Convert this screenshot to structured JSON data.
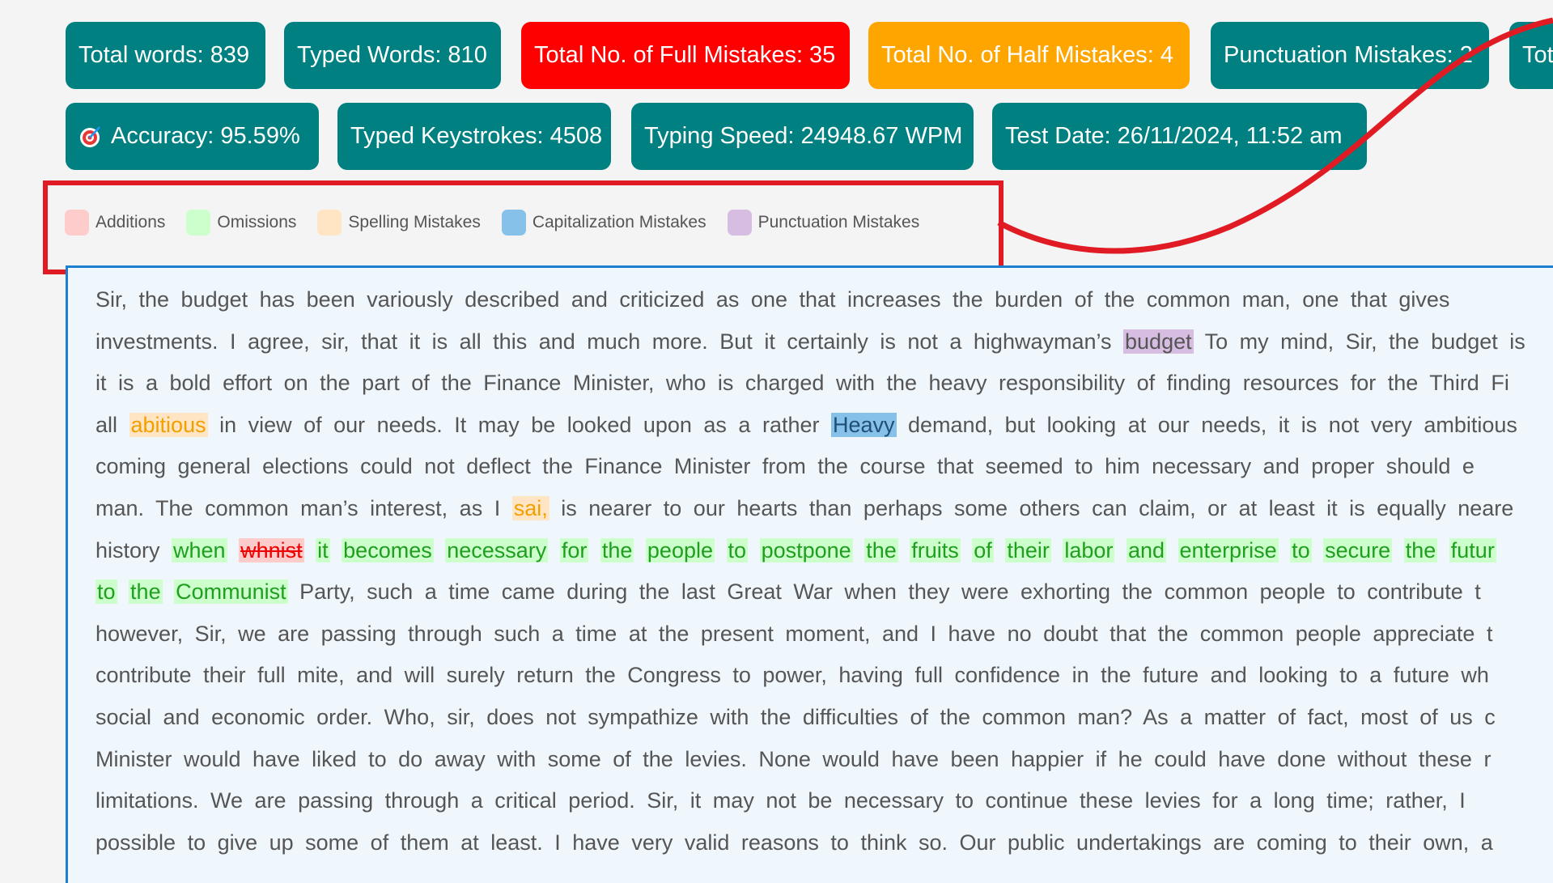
{
  "stats_row1": [
    {
      "label": "Total words: 839",
      "color": "#008080"
    },
    {
      "label": "Typed Words: 810",
      "color": "#008080"
    },
    {
      "label": "Total No. of Full Mistakes: 35",
      "color": "#ff0000"
    },
    {
      "label": "Total No. of Half Mistakes: 4",
      "color": "#ffa500"
    },
    {
      "label": "Punctuation Mistakes: 2",
      "color": "#008080"
    },
    {
      "label": "Tot",
      "color": "#008080"
    }
  ],
  "stats_row2": [
    {
      "label": "Accuracy: 95.59%",
      "icon": "target-icon",
      "color": "#008080"
    },
    {
      "label": "Typed Keystrokes: 4508",
      "color": "#008080"
    },
    {
      "label": "Typing Speed: 24948.67 WPM",
      "color": "#008080"
    },
    {
      "label": "Test Date: 26/11/2024, 11:52 am",
      "color": "#008080"
    }
  ],
  "legend": [
    {
      "label": "Additions",
      "color": "#ffcccc"
    },
    {
      "label": "Omissions",
      "color": "#ccffcc"
    },
    {
      "label": "Spelling Mistakes",
      "color": "#ffe5c4"
    },
    {
      "label": "Capitalization Mistakes",
      "color": "#85c1e9"
    },
    {
      "label": "Punctuation Mistakes",
      "color": "#d7bde2"
    }
  ],
  "annotation_color": "#e01b24",
  "lines": [
    [
      {
        "t": "Sir, the budget has been variously described and criticized as one that increases the burden of the common man, one that gives"
      }
    ],
    [
      {
        "t": "investments. I agree, sir, that it is all this and much more. But it certainly is not a highwayman’s "
      },
      {
        "t": "budget",
        "c": "punct"
      },
      {
        "t": " To my mind, Sir, the budget is"
      }
    ],
    [
      {
        "t": "it is a bold effort on the part of the Finance Minister, who is charged with the heavy responsibility of finding resources for the Third Fi"
      }
    ],
    [
      {
        "t": "all "
      },
      {
        "t": "abitious",
        "c": "spelling"
      },
      {
        "t": " in view of our needs. It may be looked upon as a rather "
      },
      {
        "t": "Heavy",
        "c": "capital"
      },
      {
        "t": " demand, but looking at our needs, it is not very ambitious"
      }
    ],
    [
      {
        "t": "coming general elections could not deflect the Finance Minister from the course that seemed to him necessary and proper should e"
      }
    ],
    [
      {
        "t": "man. The common man’s interest, as I "
      },
      {
        "t": "sai,",
        "c": "spelling"
      },
      {
        "t": " is nearer to our hearts than perhaps some others can claim, or at least it is equally neare"
      }
    ],
    [
      {
        "t": "history "
      },
      {
        "t": "when",
        "c": "omission"
      },
      {
        "t": " "
      },
      {
        "t": "whnist",
        "c": "addition"
      },
      {
        "t": " "
      },
      {
        "t": "it",
        "c": "omission"
      },
      {
        "t": " "
      },
      {
        "t": "becomes",
        "c": "omission"
      },
      {
        "t": " "
      },
      {
        "t": "necessary",
        "c": "omission"
      },
      {
        "t": " "
      },
      {
        "t": "for",
        "c": "omission"
      },
      {
        "t": " "
      },
      {
        "t": "the",
        "c": "omission"
      },
      {
        "t": " "
      },
      {
        "t": "people",
        "c": "omission"
      },
      {
        "t": " "
      },
      {
        "t": "to",
        "c": "omission"
      },
      {
        "t": " "
      },
      {
        "t": "postpone",
        "c": "omission"
      },
      {
        "t": " "
      },
      {
        "t": "the",
        "c": "omission"
      },
      {
        "t": " "
      },
      {
        "t": "fruits",
        "c": "omission"
      },
      {
        "t": " "
      },
      {
        "t": "of",
        "c": "omission"
      },
      {
        "t": " "
      },
      {
        "t": "their",
        "c": "omission"
      },
      {
        "t": " "
      },
      {
        "t": "labor",
        "c": "omission"
      },
      {
        "t": " "
      },
      {
        "t": "and",
        "c": "omission"
      },
      {
        "t": " "
      },
      {
        "t": "enterprise",
        "c": "omission"
      },
      {
        "t": " "
      },
      {
        "t": "to",
        "c": "omission"
      },
      {
        "t": " "
      },
      {
        "t": "secure",
        "c": "omission"
      },
      {
        "t": " "
      },
      {
        "t": "the",
        "c": "omission"
      },
      {
        "t": " "
      },
      {
        "t": "futur",
        "c": "omission"
      }
    ],
    [
      {
        "t": "to",
        "c": "omission"
      },
      {
        "t": " "
      },
      {
        "t": "the",
        "c": "omission"
      },
      {
        "t": " "
      },
      {
        "t": "Communist",
        "c": "omission"
      },
      {
        "t": " Party, such a time came during the last Great War when they were exhorting the common people to contribute t"
      }
    ],
    [
      {
        "t": "however, Sir, we are passing through such a time at the present moment, and I have no doubt that the common people appreciate t"
      }
    ],
    [
      {
        "t": "contribute their full mite, and will surely return the Congress to power, having full confidence in the future and looking to a future wh"
      }
    ],
    [
      {
        "t": "social and economic order. Who, sir, does not sympathize with the difficulties of the common man? As a matter of fact, most of us c"
      }
    ],
    [
      {
        "t": "Minister would have liked to do away with some of the levies. None would have been happier if he could have done without these r"
      }
    ],
    [
      {
        "t": "limitations. We are passing through a critical period. Sir, it may not be necessary to continue these levies for a long time; rather, I"
      }
    ],
    [
      {
        "t": "possible to give up some of them at least. I have very valid reasons to think so. Our public undertakings are coming to their own, a"
      }
    ]
  ]
}
